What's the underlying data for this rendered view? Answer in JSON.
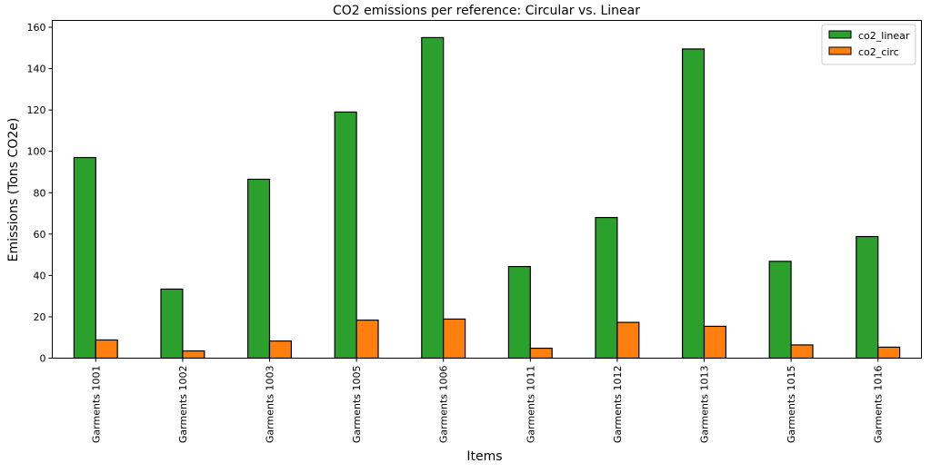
{
  "chart_data": {
    "type": "bar",
    "title": "CO2 emissions per reference: Circular vs. Linear",
    "xlabel": "Items",
    "ylabel": "Emissions (Tons CO2e)",
    "categories": [
      "Garments 1001",
      "Garments 1002",
      "Garments 1003",
      "Garments 1005",
      "Garments 1006",
      "Garments 1011",
      "Garments 1012",
      "Garments 1013",
      "Garments 1015",
      "Garments 1016"
    ],
    "series": [
      {
        "name": "co2_linear",
        "color": "#2ca02c",
        "values": [
          97.0,
          33.4,
          86.5,
          119.0,
          155.0,
          44.3,
          68.0,
          149.5,
          46.8,
          58.8
        ]
      },
      {
        "name": "co2_circ",
        "color": "#ff7f0e",
        "values": [
          8.8,
          3.5,
          8.3,
          18.4,
          18.9,
          4.8,
          17.3,
          15.4,
          6.4,
          5.3
        ]
      }
    ],
    "ylim": [
      0,
      163.3
    ],
    "yticks": [
      0,
      20,
      40,
      60,
      80,
      100,
      120,
      140,
      160
    ],
    "xtick_rotation": 90,
    "grid": false,
    "legend": {
      "placement": "top-right",
      "entries": [
        "co2_linear",
        "co2_circ"
      ]
    }
  }
}
